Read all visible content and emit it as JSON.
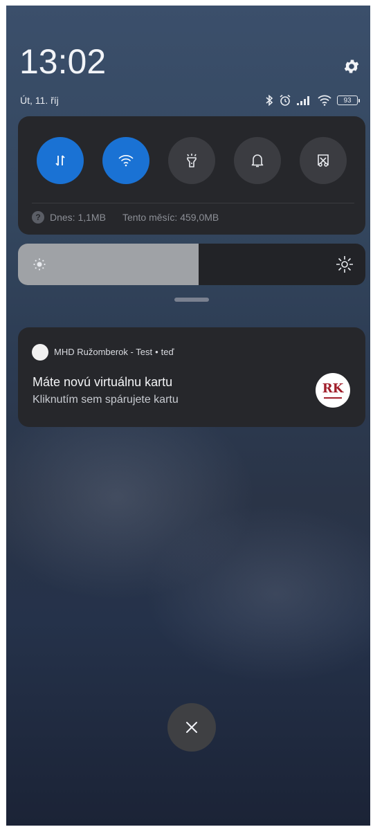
{
  "status": {
    "time": "13:02",
    "date": "Út, 11. říj",
    "battery": "93",
    "icons": [
      "bluetooth-icon",
      "alarm-icon",
      "signal-icon",
      "wifi-icon",
      "battery-icon"
    ]
  },
  "quick_settings": {
    "toggles": [
      {
        "name": "mobile-data",
        "icon": "data-transfer-icon",
        "active": true
      },
      {
        "name": "wifi",
        "icon": "wifi-icon",
        "active": true
      },
      {
        "name": "flashlight",
        "icon": "flashlight-icon",
        "active": false
      },
      {
        "name": "notifications",
        "icon": "bell-icon",
        "active": false
      },
      {
        "name": "screenshot",
        "icon": "scissors-screenshot-icon",
        "active": false
      }
    ],
    "data_usage": {
      "help": "?",
      "today": "Dnes: 1,1MB",
      "month": "Tento měsíc: 459,0MB"
    }
  },
  "brightness": {
    "level": 0.52
  },
  "notification": {
    "app_name": "MHD Ružomberok - Test",
    "separator": "•",
    "time": "teď",
    "title": "Máte novú virtuálnu kartu",
    "body": "Kliknutím sem spárujete kartu",
    "logo_text": "RK"
  },
  "colors": {
    "accent": "#1a72d4",
    "panel": "#26272b",
    "logo": "#a01e2a"
  }
}
